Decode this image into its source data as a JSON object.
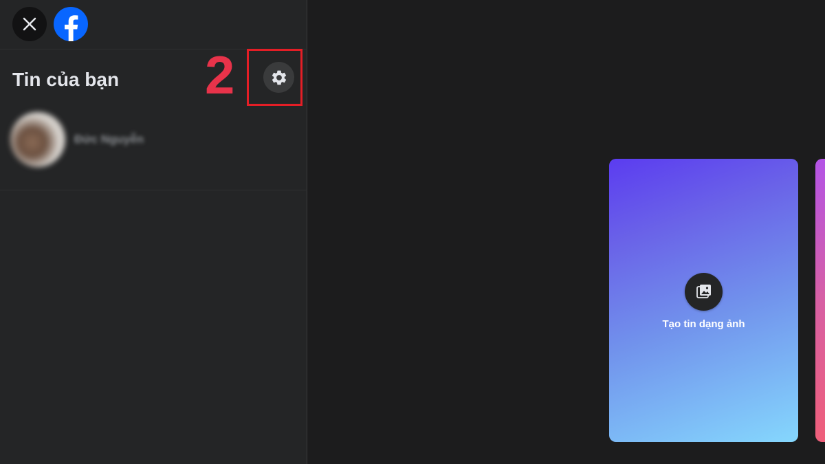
{
  "sidebar": {
    "title": "Tin của bạn",
    "story": {
      "name": "Đức Nguyễn"
    }
  },
  "annotation": {
    "step": "2",
    "highlight_color": "#e41e26",
    "step_color": "#e8334a"
  },
  "cards": {
    "photo_story_label": "Tạo tin dạng ảnh"
  },
  "icons": {
    "close": "close-icon",
    "logo": "facebook-logo",
    "settings": "gear-icon",
    "photo": "photo-gallery-icon"
  },
  "colors": {
    "facebook_blue": "#0866ff",
    "sidebar_bg": "#242526",
    "page_bg": "#1c1c1d"
  }
}
